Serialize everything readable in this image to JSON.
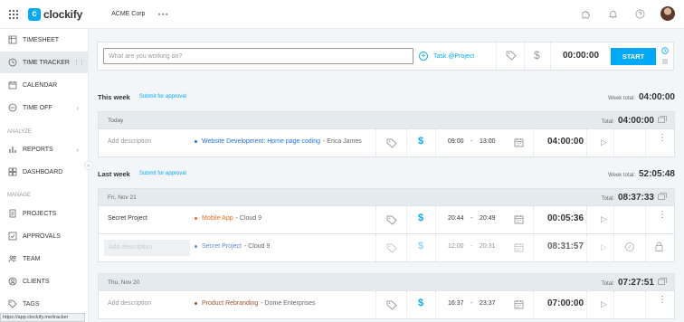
{
  "topbar": {
    "logo_mark": "c",
    "logo_text": "clockify",
    "workspace": "ACME Corp",
    "workspace_more": "•••",
    "icons": [
      "puzzle-icon",
      "bell-icon",
      "help-icon",
      "avatar"
    ]
  },
  "sidebar": {
    "items": [
      {
        "label": "Timesheet",
        "icon": "timesheet-icon"
      },
      {
        "label": "Time Tracker",
        "icon": "clock-icon",
        "active": true
      },
      {
        "label": "Calendar",
        "icon": "calendar-icon"
      },
      {
        "label": "Time Off",
        "icon": "time-off-icon"
      },
      {
        "label": "Reports",
        "icon": "reports-icon"
      },
      {
        "label": "Dashboard",
        "icon": "dashboard-icon"
      },
      {
        "label": "Projects",
        "icon": "projects-icon"
      },
      {
        "label": "Approvals",
        "icon": "approvals-icon"
      },
      {
        "label": "Team",
        "icon": "team-icon"
      },
      {
        "label": "Clients",
        "icon": "clients-icon"
      },
      {
        "label": "Tags",
        "icon": "tags-icon"
      }
    ],
    "sections": {
      "analyze": "Analyze",
      "manage": "Manage"
    },
    "collapse": "«"
  },
  "status_url": "https://app.clockify.me/tracker",
  "timer": {
    "placeholder": "What are you working on?",
    "task_project": "Task @Project",
    "dollar": "$",
    "time": "00:00:00",
    "start_label": "Start"
  },
  "this_week": {
    "title": "This week",
    "submit": "Submit for approval",
    "total_label": "Week total:",
    "total": "04:00:00",
    "days": [
      {
        "label": "Today",
        "total_label": "Total:",
        "total": "04:00:00",
        "entries": [
          {
            "description": "Add description",
            "project": "Website Development: Home page coding",
            "client": "- Erica James",
            "start": "09:00",
            "end": "13:00",
            "duration": "04:00:00"
          }
        ]
      }
    ]
  },
  "last_week": {
    "title": "Last week",
    "submit": "Submit for approval",
    "total_label": "Week total:",
    "total": "52:05:48",
    "days": [
      {
        "label": "Fri, Nov 21",
        "total_label": "Total:",
        "total": "08:37:33",
        "entries": [
          {
            "description": "Secret Project",
            "project": "Mobile App",
            "client": "- Cloud 9",
            "start": "20:44",
            "end": "20:49",
            "duration": "00:05:36"
          },
          {
            "description": "Add description",
            "project": "Secret Project",
            "client": "- Cloud 9",
            "start": "12:00",
            "end": "20:31",
            "duration": "08:31:57"
          }
        ]
      },
      {
        "label": "Thu, Nov 20",
        "total_label": "Total:",
        "total": "07:27:51",
        "entries": [
          {
            "description": "Add description",
            "project": "Product Rebranding",
            "client": "- Dome Enterprises",
            "start": "16:37",
            "end": "23:37",
            "duration": "07:00:00"
          }
        ]
      }
    ]
  },
  "colors": {
    "accent": "#03a9f4",
    "project_website": "#1e73d9",
    "project_mobile": "#e86d1f",
    "project_secret": "#5b8ac9",
    "project_rebranding": "#a0522d"
  },
  "symbols": {
    "dash": "-",
    "dollar": "$",
    "play": "▷",
    "kebab": "⋮",
    "check": "✓",
    "chevron": "›",
    "drag": "⋮⋮"
  }
}
